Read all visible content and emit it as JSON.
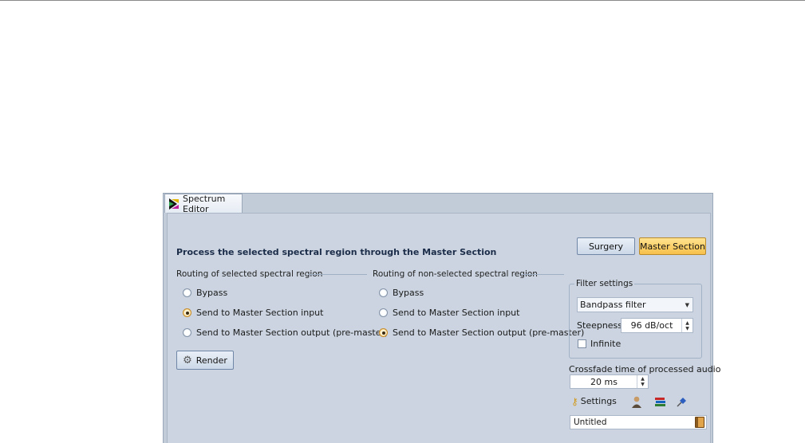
{
  "window": {
    "tab_label": "Spectrum Editor"
  },
  "header": {
    "title": "Process the selected spectral region through the Master Section",
    "mode_buttons": [
      {
        "label": "Surgery",
        "active": false
      },
      {
        "label": "Master Section",
        "active": true
      }
    ]
  },
  "routing_selected": {
    "label": "Routing of selected spectral region",
    "options": [
      {
        "label": "Bypass",
        "checked": false
      },
      {
        "label": "Send to Master Section input",
        "checked": true
      },
      {
        "label": "Send to Master Section output (pre-master)",
        "checked": false
      }
    ]
  },
  "routing_nonselected": {
    "label": "Routing of non-selected spectral region",
    "options": [
      {
        "label": "Bypass",
        "checked": false
      },
      {
        "label": "Send to Master Section input",
        "checked": false
      },
      {
        "label": "Send to Master Section output (pre-master)",
        "checked": true
      }
    ]
  },
  "render_button": {
    "label": "Render",
    "icon": "gear-icon"
  },
  "filter_settings": {
    "legend": "Filter settings",
    "filter_type": "Bandpass filter",
    "steepness_label": "Steepness",
    "steepness_value": "96 dB/oct",
    "infinite_label": "Infinite",
    "infinite_checked": false
  },
  "crossfade": {
    "label": "Crossfade time of processed audio",
    "value": "20 ms"
  },
  "footer": {
    "settings_label": "Settings",
    "settings_icon": "key-icon",
    "icons": [
      "user-icon",
      "books-icon",
      "pin-icon"
    ],
    "preset_name": "Untitled",
    "preset_icon": "book-icon"
  },
  "colors": {
    "panel_bg": "#cbd4e0",
    "active_button": "#f7c04b",
    "title_text": "#1c2d4a"
  }
}
